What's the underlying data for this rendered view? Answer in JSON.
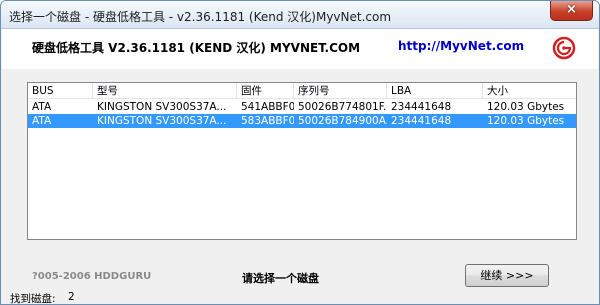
{
  "window": {
    "title": "选择一个磁盘 - 硬盘低格工具 - v2.36.1181 (Kend 汉化)MyvNet.com",
    "close_label": "×"
  },
  "header": {
    "app_title": "硬盘低格工具 V2.36.1181 (KEND 汉化) MYVNET.COM",
    "site_link": "http://MyvNet.com",
    "logo_icon": "red-circle-logo-icon"
  },
  "disk_list": {
    "columns": [
      "BUS",
      "型号",
      "固件",
      "序列号",
      "LBA",
      "大小"
    ],
    "rows": [
      {
        "bus": "ATA",
        "model": "KINGSTON SV300S37A...",
        "firmware": "541ABBF0",
        "serial": "50026B774801F...",
        "lba": "234441648",
        "size": "120.03 Gbytes",
        "selected": false
      },
      {
        "bus": "ATA",
        "model": "KINGSTON SV300S37A...",
        "firmware": "583ABBF0",
        "serial": "50026B784900A...",
        "lba": "234441648",
        "size": "120.03 Gbytes",
        "selected": true
      }
    ]
  },
  "footer": {
    "copyright": "?005-2006 HDDGURU",
    "prompt": "请选择一个磁盘",
    "continue_label": "继续 >>>"
  },
  "status": {
    "label": "找到磁盘:",
    "count": "2"
  },
  "colors": {
    "selection": "#3399ff",
    "link": "#0000cc",
    "close_button": "#c7412b"
  }
}
